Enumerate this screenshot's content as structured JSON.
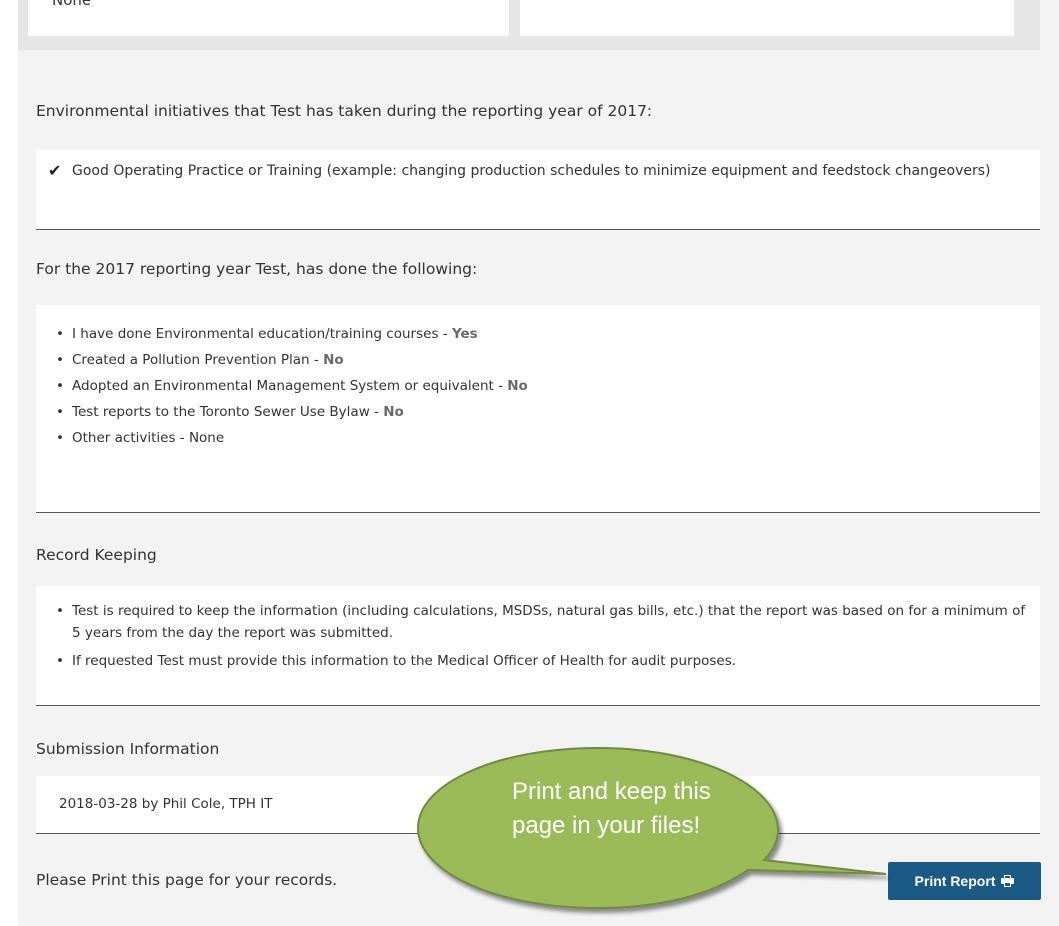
{
  "top_cards": {
    "left_cut_text": "None"
  },
  "environmental": {
    "heading": "Environmental initiatives that Test has taken during the reporting year of 2017:",
    "item": "Good Operating Practice or Training (example: changing production schedules to minimize equipment and feedstock changeovers)"
  },
  "activities": {
    "heading": "For the 2017 reporting year Test, has done the following:",
    "items": [
      {
        "label": "I have done Environmental education/training courses - ",
        "answer": "Yes"
      },
      {
        "label": "Created a Pollution Prevention Plan - ",
        "answer": "No"
      },
      {
        "label": "Adopted an Environmental Management System or equivalent - ",
        "answer": "No"
      },
      {
        "label": "Test reports to the Toronto Sewer Use Bylaw - ",
        "answer": "No"
      },
      {
        "label": "Other activities - None",
        "answer": ""
      }
    ]
  },
  "record_keeping": {
    "heading": "Record Keeping",
    "items": [
      "Test is required to keep the information (including calculations, MSDSs, natural gas bills, etc.) that the report was based on for a minimum of 5 years from the day the report was submitted.",
      "If requested Test must provide this information to the Medical Officer of Health for audit purposes."
    ]
  },
  "submission": {
    "heading": "Submission Information",
    "value": "2018-03-28 by Phil Cole, TPH IT"
  },
  "footer": {
    "note": "Please Print this page for your records.",
    "print_label": "Print Report"
  },
  "callout": {
    "text": "Print and keep this page in your files!",
    "fill": "#9bbb59",
    "stroke": "#71893f"
  },
  "colors": {
    "button": "#1c5a86",
    "page_bg": "#f3f3f3"
  }
}
